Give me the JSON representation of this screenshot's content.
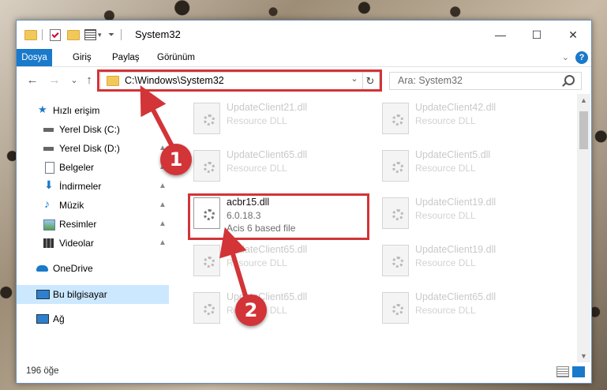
{
  "window": {
    "title": "System32"
  },
  "window_controls": {
    "minimize": "—",
    "maximize": "☐",
    "close": "✕"
  },
  "ribbon": {
    "tabs": [
      "Dosya",
      "Giriş",
      "Paylaş",
      "Görünüm"
    ],
    "help": "?",
    "collapse": "⌄"
  },
  "navbar": {
    "back": "←",
    "forward": "→",
    "recent": "⌄",
    "up": "↑",
    "address": "C:\\Windows\\System32",
    "address_dropdown": "⌄",
    "refresh": "↻",
    "search_placeholder": "Ara: System32"
  },
  "sidebar": {
    "items": [
      {
        "label": "Hızlı erişim",
        "icon": "star-icon",
        "pinned": false
      },
      {
        "label": "Yerel Disk (C:)",
        "icon": "drive-icon",
        "pinned": true
      },
      {
        "label": "Yerel Disk (D:)",
        "icon": "drive-icon",
        "pinned": true
      },
      {
        "label": "Belgeler",
        "icon": "documents-icon",
        "pinned": true
      },
      {
        "label": "İndirmeler",
        "icon": "download-icon",
        "pinned": true
      },
      {
        "label": "Müzik",
        "icon": "music-icon",
        "pinned": true
      },
      {
        "label": "Resimler",
        "icon": "pictures-icon",
        "pinned": true
      },
      {
        "label": "Videolar",
        "icon": "videos-icon",
        "pinned": true
      },
      {
        "label": "OneDrive",
        "icon": "cloud-icon",
        "pinned": false
      },
      {
        "label": "Bu bilgisayar",
        "icon": "computer-icon",
        "pinned": false
      },
      {
        "label": "Ağ",
        "icon": "network-icon",
        "pinned": false
      }
    ],
    "pin_glyph": "📌"
  },
  "files": [
    {
      "name": "UpdateClient21.dll",
      "line2": "Resource DLL",
      "line3": ""
    },
    {
      "name": "UpdateClient42.dll",
      "line2": "Resource DLL",
      "line3": ""
    },
    {
      "name": "UpdateClient65.dll",
      "line2": "Resource DLL",
      "line3": ""
    },
    {
      "name": "UpdateClient5.dll",
      "line2": "Resource DLL",
      "line3": ""
    },
    {
      "name": "acbr15.dll",
      "line2": "6.0.18.3",
      "line3": "Acis 6 based file"
    },
    {
      "name": "UpdateClient19.dll",
      "line2": "Resource DLL",
      "line3": ""
    },
    {
      "name": "UpdateClient65.dll",
      "line2": "Resource DLL",
      "line3": ""
    },
    {
      "name": "UpdateClient19.dll",
      "line2": "Resource DLL",
      "line3": ""
    },
    {
      "name": "UpdateClient65.dll",
      "line2": "Resource DLL",
      "line3": ""
    },
    {
      "name": "UpdateClient65.dll",
      "line2": "Resource DLL",
      "line3": ""
    }
  ],
  "status": {
    "count": "196 öğe"
  },
  "annotations": {
    "step1": "1",
    "step2": "2",
    "color": "#d23438"
  }
}
